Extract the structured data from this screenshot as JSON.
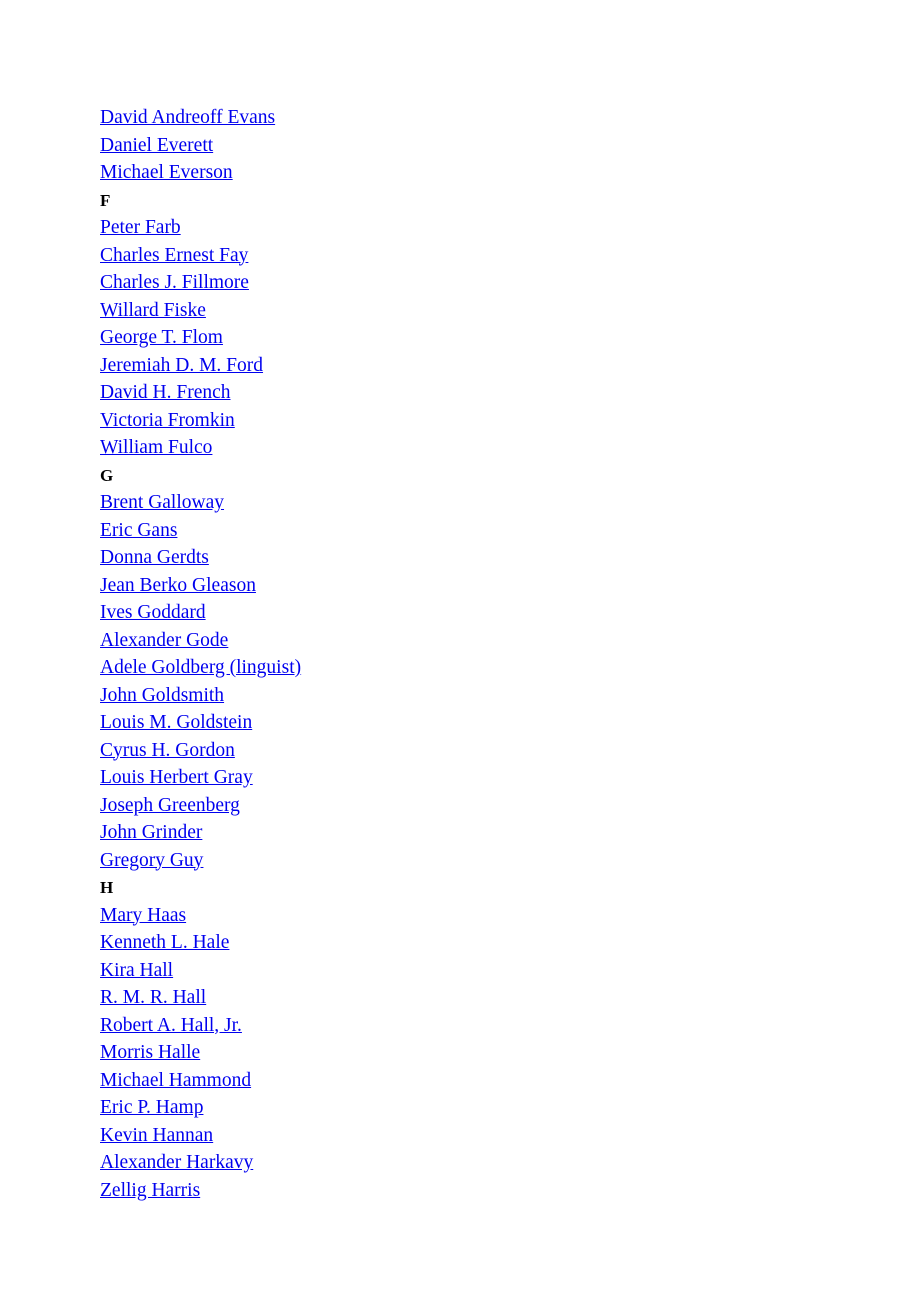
{
  "page": {
    "background_color": "#ffffff",
    "link_color": "#0000ee",
    "heading_color": "#000000"
  },
  "entries": [
    {
      "type": "link",
      "label": "David Andreoff Evans"
    },
    {
      "type": "link",
      "label": "Daniel Everett"
    },
    {
      "type": "link",
      "label": "Michael Everson"
    },
    {
      "type": "heading",
      "label": "F"
    },
    {
      "type": "link",
      "label": "Peter Farb"
    },
    {
      "type": "link",
      "label": "Charles Ernest Fay"
    },
    {
      "type": "link",
      "label": "Charles J. Fillmore"
    },
    {
      "type": "link",
      "label": "Willard Fiske"
    },
    {
      "type": "link",
      "label": "George T. Flom"
    },
    {
      "type": "link",
      "label": "Jeremiah D. M. Ford"
    },
    {
      "type": "link",
      "label": "David H. French"
    },
    {
      "type": "link",
      "label": "Victoria Fromkin"
    },
    {
      "type": "link",
      "label": "William Fulco"
    },
    {
      "type": "heading",
      "label": "G"
    },
    {
      "type": "link",
      "label": "Brent Galloway"
    },
    {
      "type": "link",
      "label": "Eric Gans"
    },
    {
      "type": "link",
      "label": "Donna Gerdts"
    },
    {
      "type": "link",
      "label": "Jean Berko Gleason"
    },
    {
      "type": "link",
      "label": "Ives Goddard"
    },
    {
      "type": "link",
      "label": "Alexander Gode"
    },
    {
      "type": "link",
      "label": "Adele Goldberg (linguist)"
    },
    {
      "type": "link",
      "label": "John Goldsmith"
    },
    {
      "type": "link",
      "label": "Louis M. Goldstein"
    },
    {
      "type": "link",
      "label": "Cyrus H. Gordon"
    },
    {
      "type": "link",
      "label": "Louis Herbert Gray"
    },
    {
      "type": "link",
      "label": "Joseph Greenberg"
    },
    {
      "type": "link",
      "label": "John Grinder"
    },
    {
      "type": "link",
      "label": "Gregory Guy"
    },
    {
      "type": "heading",
      "label": "H"
    },
    {
      "type": "link",
      "label": "Mary Haas"
    },
    {
      "type": "link",
      "label": "Kenneth L. Hale"
    },
    {
      "type": "link",
      "label": "Kira Hall"
    },
    {
      "type": "link",
      "label": "R. M. R. Hall"
    },
    {
      "type": "link",
      "label": "Robert A. Hall, Jr."
    },
    {
      "type": "link",
      "label": "Morris Halle"
    },
    {
      "type": "link",
      "label": "Michael Hammond"
    },
    {
      "type": "link",
      "label": "Eric P. Hamp"
    },
    {
      "type": "link",
      "label": "Kevin Hannan"
    },
    {
      "type": "link",
      "label": "Alexander Harkavy"
    },
    {
      "type": "link",
      "label": "Zellig Harris"
    }
  ]
}
